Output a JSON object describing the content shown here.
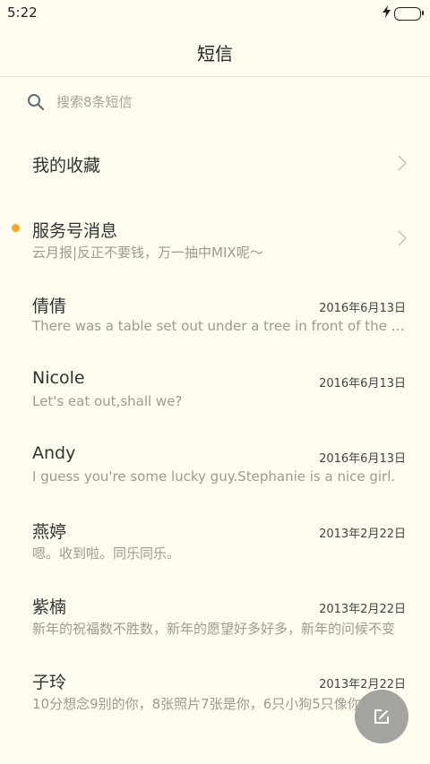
{
  "status_bar": {
    "time": "5:22",
    "battery_color": "#3fc93a"
  },
  "header": {
    "title": "短信"
  },
  "search": {
    "placeholder": "搜索8条短信"
  },
  "favorites": {
    "label": "我的收藏"
  },
  "service": {
    "name": "服务号消息",
    "preview": "云月报|反正不要钱，万一抽中MIX呢～",
    "unread_color": "#f6a623"
  },
  "conversations": [
    {
      "name": "倩倩",
      "date": "2016年6月13日",
      "preview": "There was a table set out under a tree in front of the house"
    },
    {
      "name": "Nicole",
      "date": "2016年6月13日",
      "preview": "Let's eat out,shall we?"
    },
    {
      "name": "Andy",
      "date": "2016年6月13日",
      "preview": "I guess you're some lucky guy.Stephanie is a nice girl."
    },
    {
      "name": "燕婷",
      "date": "2013年2月22日",
      "preview": "嗯。收到啦。同乐同乐。"
    },
    {
      "name": "紫楠",
      "date": "2013年2月22日",
      "preview": "新年的祝福数不胜数，新年的愿望好多好多，新年的问候不变"
    },
    {
      "name": "子玲",
      "date": "2013年2月22日",
      "preview": "10分想念9别的你，8张照片7张是你，6只小狗5只像你"
    }
  ],
  "fab": {
    "icon": "compose-icon"
  },
  "colors": {
    "background": "#fdfcee",
    "fab": "#a3a3a0"
  }
}
